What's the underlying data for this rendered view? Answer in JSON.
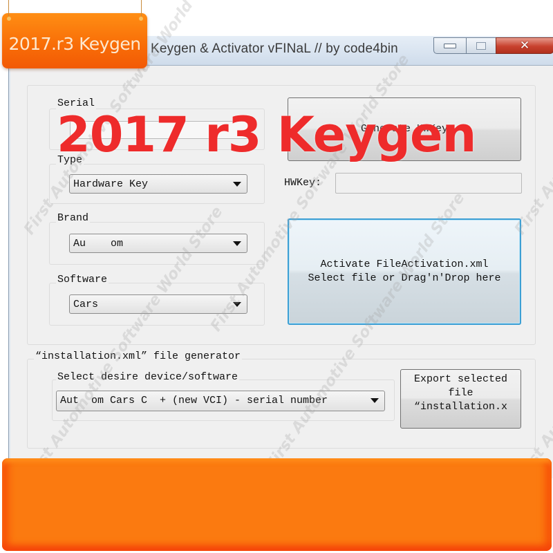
{
  "overlay": {
    "tag_label": "2017.r3 Keygen",
    "headline": "2017 r3 Keygen",
    "watermark": "First Automotive Software World Store",
    "banner_color": "#fb7a10",
    "headline_color": "#ee2b2b"
  },
  "window": {
    "title": "Keygen & Activator vFINaL // by code4bin",
    "controls": {
      "minimize": "minimize-icon",
      "maximize": "maximize-icon",
      "close": "close-icon"
    }
  },
  "form": {
    "serial": {
      "label": "Serial",
      "value": ""
    },
    "type": {
      "label": "Type",
      "selected": "Hardware Key"
    },
    "brand": {
      "label": "Brand",
      "selected": "Au    om"
    },
    "software": {
      "label": "Software",
      "selected": "Cars"
    },
    "generate_button": "Generate HWKey",
    "hwkey": {
      "label": "HWKey:",
      "value": ""
    },
    "activate_button": "Activate FileActivation.xml\nSelect file or Drag'n'Drop here"
  },
  "installation": {
    "group_label": "“installation.xml” file generator",
    "select_label": "Select desire device/software",
    "selected": "Aut  om Cars C  + (new VCI) - serial number",
    "export_button": "Export selected\nfile\n“installation.x"
  }
}
